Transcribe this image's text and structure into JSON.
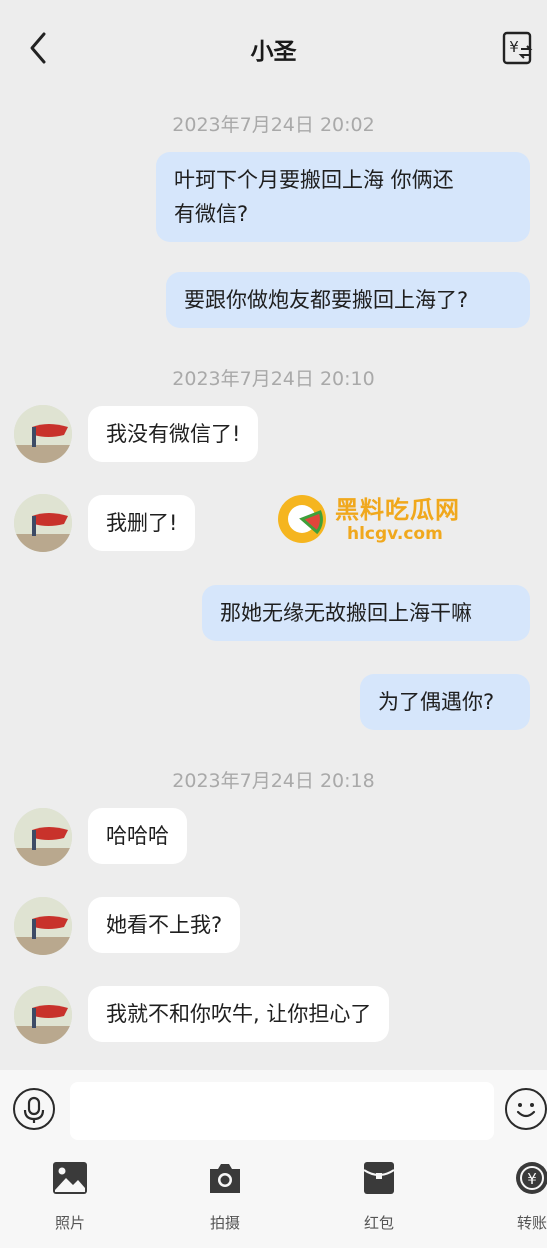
{
  "header": {
    "title": "小圣"
  },
  "messages": {
    "ts1": "2023年7月24日 20:02",
    "m1": "叶珂下个月要搬回上海 你俩还\n有微信?",
    "m2": "要跟你做炮友都要搬回上海了?",
    "ts2": "2023年7月24日 20:10",
    "m3": "我没有微信了!",
    "m4": "我删了!",
    "m5": "那她无缘无故搬回上海干嘛",
    "m6": "为了偶遇你?",
    "ts3": "2023年7月24日 20:18",
    "m7": "哈哈哈",
    "m8": "她看不上我?",
    "m9": "我就不和你吹牛, 让你担心了"
  },
  "watermark": {
    "text": "黑料吃瓜网",
    "url": "hlcgv.com"
  },
  "input": {
    "placeholder": ""
  },
  "toolbar": {
    "photo": "照片",
    "camera": "拍摄",
    "redpacket": "红包",
    "transfer": "转账"
  },
  "colors": {
    "outgoing_bubble": "#d6e6fb",
    "incoming_bubble": "#ffffff",
    "background": "#ededed",
    "watermark": "#f0a81d"
  }
}
